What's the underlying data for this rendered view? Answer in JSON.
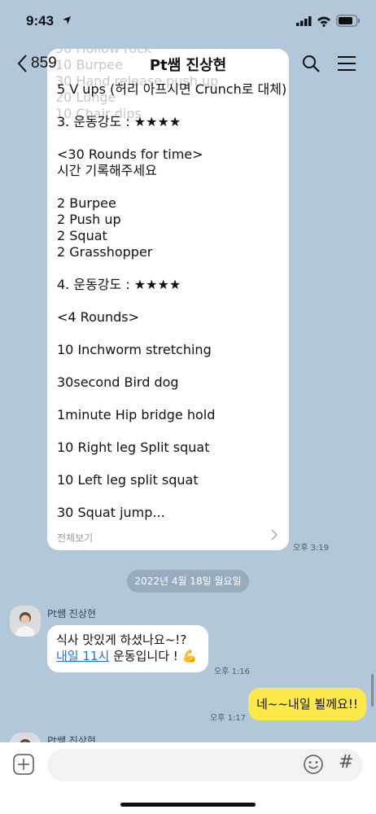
{
  "status_bar": {
    "time": "9:43"
  },
  "nav": {
    "back_count": "859",
    "title": "Pt쌤 진상현"
  },
  "long_message": {
    "scrolled_lines": [
      "50 Hollow rock",
      "10 Burpee",
      "30 Hand release push up",
      "20 Lunge",
      "10 Chair dips"
    ],
    "lines": [
      "5 V ups (허리 아프시면 Crunch로 대체)",
      "",
      "3. 운동강도 : ★★★★",
      "",
      "<30 Rounds for time>",
      "시간 기록해주세요",
      "",
      "2 Burpee",
      "2 Push up",
      "2 Squat",
      "2 Grasshopper",
      "",
      "4. 운동강도 : ★★★★",
      "",
      "<4 Rounds>",
      "",
      "10 Inchworm stretching",
      "",
      "30second Bird dog",
      "",
      "1minute Hip bridge hold",
      "",
      "10 Right leg Split squat",
      "",
      "10 Left leg split squat",
      "",
      "30 Squat jump..."
    ],
    "see_all": "전체보기",
    "time": "오후 3:19"
  },
  "date_divider": "2022년 4월 18일 월요일",
  "incoming": {
    "sender": "Pt쌤 진상현",
    "line1": "식사 맛있게 하셨나요~!?",
    "link_text": "내일 11시",
    "line2_rest": " 운동입니다 ! 💪",
    "time": "오후 1:16"
  },
  "outgoing": {
    "text": "네~~내일 뵐께요!!",
    "time": "오후 1:17"
  },
  "next_sender": "Pt쌤 진상현",
  "input": {
    "placeholder": "",
    "hash": "#"
  },
  "colors": {
    "chat_bg": "#b2c7d9",
    "my_bubble": "#fde94a",
    "link": "#1a73e8"
  }
}
